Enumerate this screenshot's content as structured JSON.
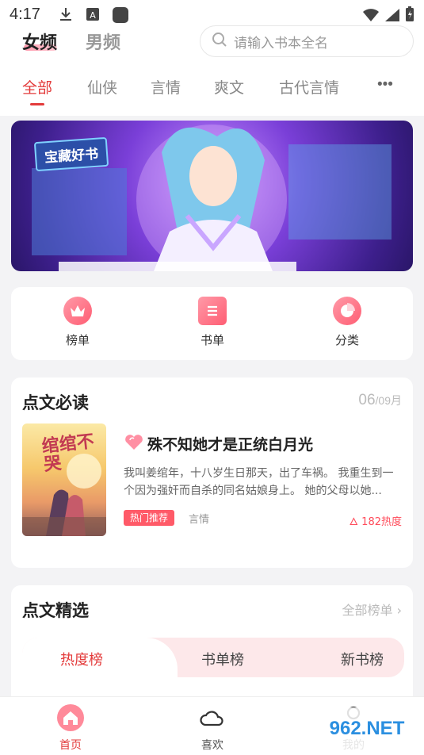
{
  "status_bar": {
    "time": "4:17",
    "icons": [
      "download-icon",
      "a-icon",
      "app-icon",
      "wifi-icon",
      "signal-icon",
      "battery-icon"
    ]
  },
  "header": {
    "gender_tabs": [
      {
        "label": "女频",
        "active": true
      },
      {
        "label": "男频",
        "active": false
      }
    ],
    "search_placeholder": "请输入书本全名",
    "category_tabs": [
      {
        "label": "全部",
        "active": true
      },
      {
        "label": "仙侠",
        "active": false
      },
      {
        "label": "言情",
        "active": false
      },
      {
        "label": "爽文",
        "active": false
      },
      {
        "label": "古代言情",
        "active": false
      }
    ],
    "more_label": "•••"
  },
  "banner": {
    "badge": "宝藏好书"
  },
  "quick_nav": [
    {
      "label": "榜单",
      "icon": "crown-icon"
    },
    {
      "label": "书单",
      "icon": "list-icon"
    },
    {
      "label": "分类",
      "icon": "pie-icon"
    }
  ],
  "must_read": {
    "title": "点文必读",
    "date_main": "06",
    "date_sub": "/09月",
    "book": {
      "cover_title": "绾绾不哭",
      "title": "殊不知她才是正统白月光",
      "description": "我叫姜绾年，十八岁生日那天，出了车祸。 我重生到一个因为强奸而自杀的同名姑娘身上。 她的父母以她...",
      "tag": "热门推荐",
      "genre": "言情",
      "heat": "182热度"
    }
  },
  "selection": {
    "title": "点文精选",
    "all_list": "全部榜单 ›",
    "tabs": [
      {
        "label": "热度榜",
        "active": true
      },
      {
        "label": "书单榜",
        "active": false
      },
      {
        "label": "新书榜",
        "active": false
      }
    ]
  },
  "bottom_nav": [
    {
      "label": "首页",
      "active": true,
      "icon": "home-icon"
    },
    {
      "label": "喜欢",
      "active": false,
      "icon": "cloud-icon"
    },
    {
      "label": "我的",
      "active": false,
      "icon": "user-icon"
    }
  ],
  "watermark": "962.NET",
  "colors": {
    "accent": "#e33b3b",
    "pink": "#ff5a68",
    "banner_purple": "#7a3fd8"
  }
}
